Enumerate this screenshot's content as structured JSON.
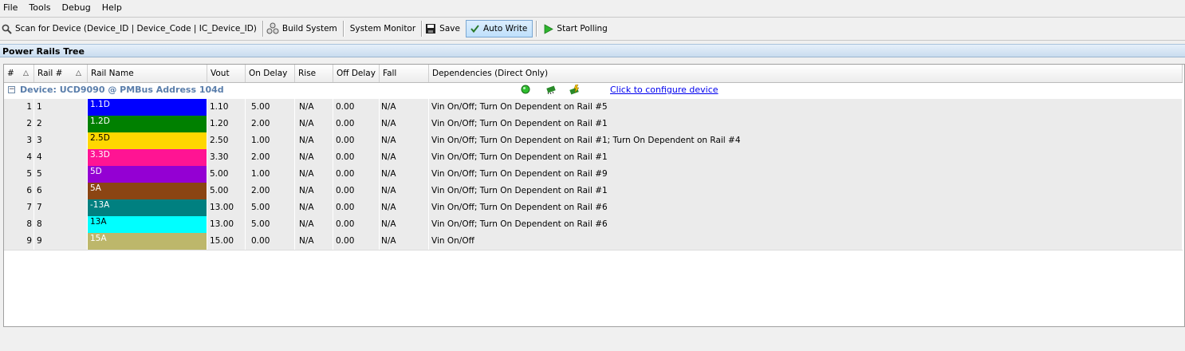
{
  "menu": [
    "File",
    "Tools",
    "Debug",
    "Help"
  ],
  "toolbar": {
    "scan_label": "Scan for Device (Device_ID | Device_Code | IC_Device_ID)",
    "build_label": "Build System",
    "monitor_label": "System Monitor",
    "save_label": "Save",
    "autowrite_label": "Auto Write",
    "polling_label": "Start Polling"
  },
  "panel": {
    "title": "Power Rails Tree"
  },
  "table": {
    "headers": {
      "num": "#",
      "rail": "Rail #",
      "name": "Rail Name",
      "vout": "Vout",
      "on_delay": "On Delay",
      "rise": "Rise",
      "off_delay": "Off Delay",
      "fall": "Fall",
      "deps": "Dependencies  (Direct Only)"
    },
    "group": {
      "label": "Device: UCD9090 @ PMBus Address 104d",
      "configure_link": "Click to configure device"
    },
    "rows": [
      {
        "num": "1",
        "rail": "1",
        "name": "1.1D",
        "color": "#0000ff",
        "text_color": "#ffffff",
        "vout": "1.10",
        "on_delay": "5.00",
        "rise": "N/A",
        "off_delay": "0.00",
        "fall": "N/A",
        "deps": "Vin On/Off; Turn On Dependent on Rail #5"
      },
      {
        "num": "2",
        "rail": "2",
        "name": "1.2D",
        "color": "#008000",
        "text_color": "#ffffff",
        "vout": "1.20",
        "on_delay": "2.00",
        "rise": "N/A",
        "off_delay": "0.00",
        "fall": "N/A",
        "deps": "Vin On/Off; Turn On Dependent on Rail #1"
      },
      {
        "num": "3",
        "rail": "3",
        "name": "2.5D",
        "color": "#ffd700",
        "text_color": "#000000",
        "vout": "2.50",
        "on_delay": "1.00",
        "rise": "N/A",
        "off_delay": "0.00",
        "fall": "N/A",
        "deps": "Vin On/Off; Turn On Dependent on Rail #1; Turn On Dependent on Rail #4"
      },
      {
        "num": "4",
        "rail": "4",
        "name": "3.3D",
        "color": "#ff1493",
        "text_color": "#ffffff",
        "vout": "3.30",
        "on_delay": "2.00",
        "rise": "N/A",
        "off_delay": "0.00",
        "fall": "N/A",
        "deps": "Vin On/Off; Turn On Dependent on Rail #1"
      },
      {
        "num": "5",
        "rail": "5",
        "name": "5D",
        "color": "#9400d3",
        "text_color": "#ffffff",
        "vout": "5.00",
        "on_delay": "1.00",
        "rise": "N/A",
        "off_delay": "0.00",
        "fall": "N/A",
        "deps": "Vin On/Off; Turn On Dependent on Rail #9"
      },
      {
        "num": "6",
        "rail": "6",
        "name": "5A",
        "color": "#8b4513",
        "text_color": "#ffffff",
        "vout": "5.00",
        "on_delay": "2.00",
        "rise": "N/A",
        "off_delay": "0.00",
        "fall": "N/A",
        "deps": "Vin On/Off; Turn On Dependent on Rail #1"
      },
      {
        "num": "7",
        "rail": "7",
        "name": "-13A",
        "color": "#008080",
        "text_color": "#ffffff",
        "vout": "13.00",
        "on_delay": "5.00",
        "rise": "N/A",
        "off_delay": "0.00",
        "fall": "N/A",
        "deps": "Vin On/Off; Turn On Dependent on Rail #6"
      },
      {
        "num": "8",
        "rail": "8",
        "name": "13A",
        "color": "#00ffff",
        "text_color": "#000000",
        "vout": "13.00",
        "on_delay": "5.00",
        "rise": "N/A",
        "off_delay": "0.00",
        "fall": "N/A",
        "deps": "Vin On/Off; Turn On Dependent on Rail #6"
      },
      {
        "num": "9",
        "rail": "9",
        "name": "15A",
        "color": "#bdb76b",
        "text_color": "#ffffff",
        "vout": "15.00",
        "on_delay": "0.00",
        "rise": "N/A",
        "off_delay": "0.00",
        "fall": "N/A",
        "deps": "Vin On/Off"
      }
    ]
  },
  "colors": {
    "accent": "#5a7eab",
    "link": "#0000ee",
    "row_bg": "#ebebeb"
  }
}
